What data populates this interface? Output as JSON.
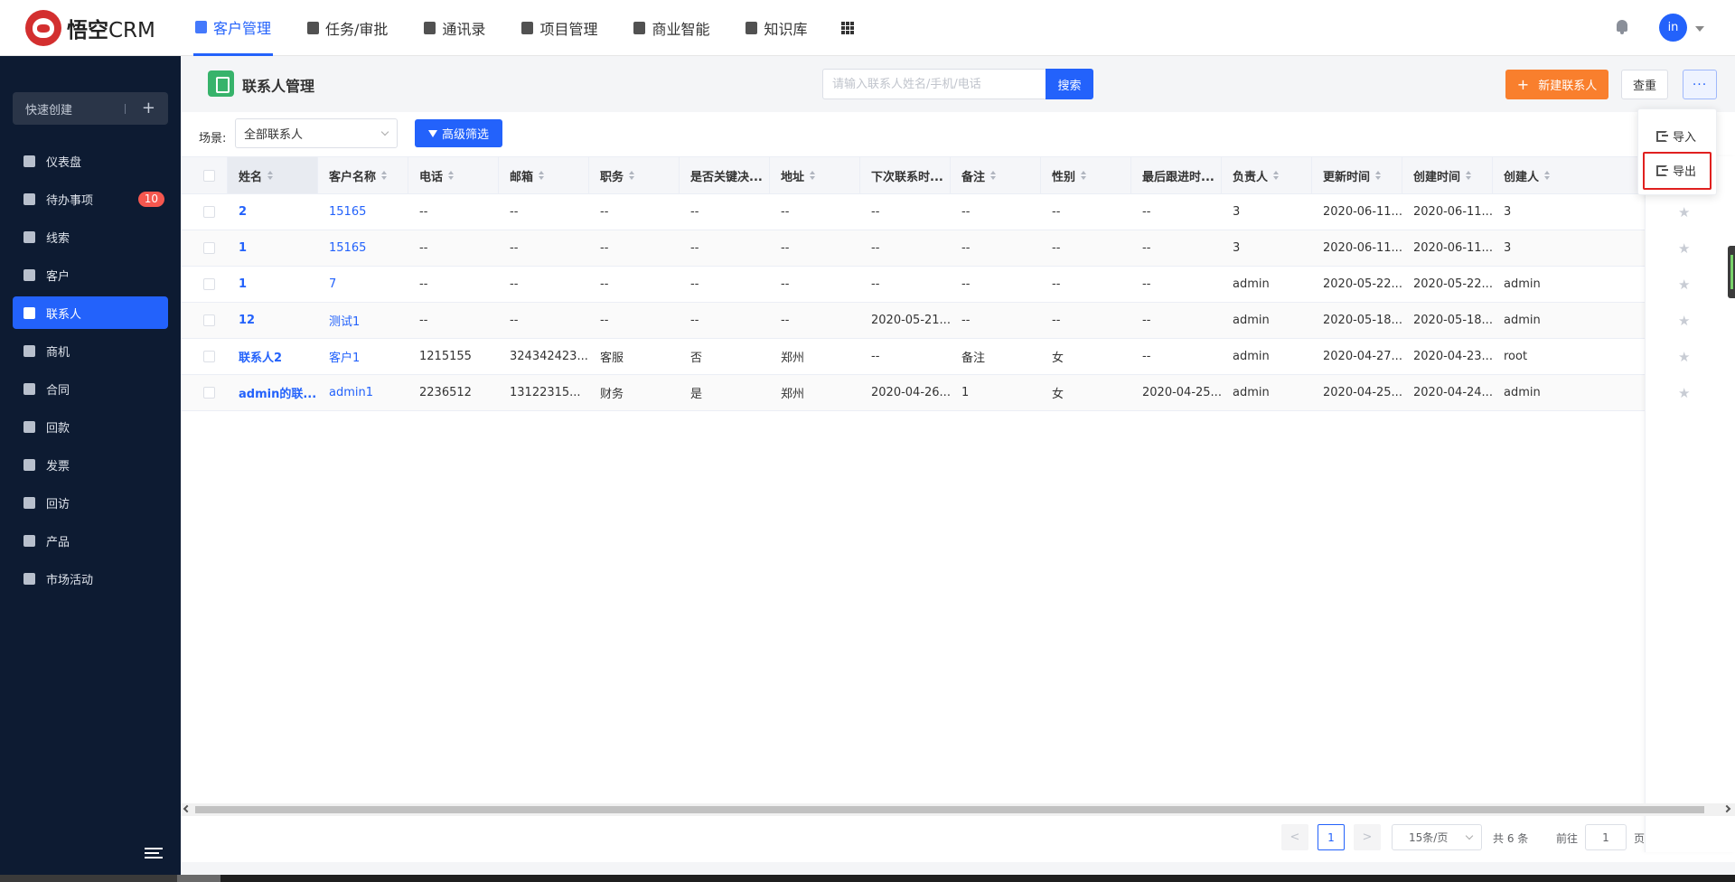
{
  "brand": {
    "name_bold": "悟空",
    "name_rest": "CRM"
  },
  "topnav": [
    {
      "label": "客户管理",
      "icon": "customer-icon",
      "active": true
    },
    {
      "label": "任务/审批",
      "icon": "briefcase-icon",
      "active": false
    },
    {
      "label": "通讯录",
      "icon": "contacts-book-icon",
      "active": false
    },
    {
      "label": "项目管理",
      "icon": "project-icon",
      "active": false
    },
    {
      "label": "商业智能",
      "icon": "bi-icon",
      "active": false
    },
    {
      "label": "知识库",
      "icon": "book-icon",
      "active": false
    }
  ],
  "user": {
    "avatar_text": "in"
  },
  "sidebar": {
    "quick_create": "快速创建",
    "items": [
      {
        "label": "仪表盘",
        "icon": "dashboard-icon"
      },
      {
        "label": "待办事项",
        "icon": "todo-icon",
        "badge": "10"
      },
      {
        "label": "线索",
        "icon": "lead-icon"
      },
      {
        "label": "客户",
        "icon": "customer-icon"
      },
      {
        "label": "联系人",
        "icon": "contact-icon",
        "active": true
      },
      {
        "label": "商机",
        "icon": "opportunity-icon"
      },
      {
        "label": "合同",
        "icon": "contract-icon"
      },
      {
        "label": "回款",
        "icon": "payment-icon"
      },
      {
        "label": "发票",
        "icon": "invoice-icon"
      },
      {
        "label": "回访",
        "icon": "home-icon"
      },
      {
        "label": "产品",
        "icon": "product-icon"
      },
      {
        "label": "市场活动",
        "icon": "send-icon"
      }
    ]
  },
  "header": {
    "title": "联系人管理",
    "search_placeholder": "请输入联系人姓名/手机/电话",
    "search_button": "搜索",
    "new_button": "新建联系人",
    "dedupe_button": "查重",
    "more_button": "···"
  },
  "filters": {
    "scene_label": "场景:",
    "scene_value": "全部联系人",
    "advanced_filter": "高级筛选"
  },
  "table": {
    "columns": [
      "姓名",
      "客户名称",
      "电话",
      "邮箱",
      "职务",
      "是否关键决...",
      "地址",
      "下次联系时...",
      "备注",
      "性别",
      "最后跟进时...",
      "负责人",
      "更新时间",
      "创建时间",
      "创建人"
    ],
    "rows": [
      [
        "2",
        "15165",
        "--",
        "--",
        "--",
        "--",
        "--",
        "--",
        "--",
        "--",
        "--",
        "3",
        "2020-06-11...",
        "2020-06-11...",
        "3"
      ],
      [
        "1",
        "15165",
        "--",
        "--",
        "--",
        "--",
        "--",
        "--",
        "--",
        "--",
        "--",
        "3",
        "2020-06-11...",
        "2020-06-11...",
        "3"
      ],
      [
        "1",
        "7",
        "--",
        "--",
        "--",
        "--",
        "--",
        "--",
        "--",
        "--",
        "--",
        "admin",
        "2020-05-22...",
        "2020-05-22...",
        "admin"
      ],
      [
        "12",
        "测试1",
        "--",
        "--",
        "--",
        "--",
        "--",
        "2020-05-21...",
        "--",
        "--",
        "--",
        "admin",
        "2020-05-18...",
        "2020-05-18...",
        "admin"
      ],
      [
        "联系人2",
        "客户1",
        "1215155",
        "324342423...",
        "客服",
        "否",
        "郑州",
        "--",
        "备注",
        "女",
        "--",
        "admin",
        "2020-04-27...",
        "2020-04-23...",
        "root"
      ],
      [
        "admin的联...",
        "admin1",
        "2236512",
        "13122315...",
        "财务",
        "是",
        "郑州",
        "2020-04-26...",
        "1",
        "女",
        "2020-04-25...",
        "admin",
        "2020-04-25...",
        "2020-04-24...",
        "admin"
      ]
    ]
  },
  "pagination": {
    "prev": "<",
    "current": "1",
    "next": ">",
    "page_size": "15条/页",
    "total": "共 6 条",
    "goto_label": "前往",
    "goto_value": "1",
    "page_unit": "页"
  },
  "dropdown": {
    "items": [
      {
        "label": "导入",
        "icon": "import-icon"
      },
      {
        "label": "导出",
        "icon": "export-icon",
        "highlighted": true
      }
    ]
  },
  "colors": {
    "primary": "#2362fb",
    "orange": "#f97f2d",
    "sidebar_bg": "#0d1b32",
    "highlight_border": "#e0201f"
  }
}
